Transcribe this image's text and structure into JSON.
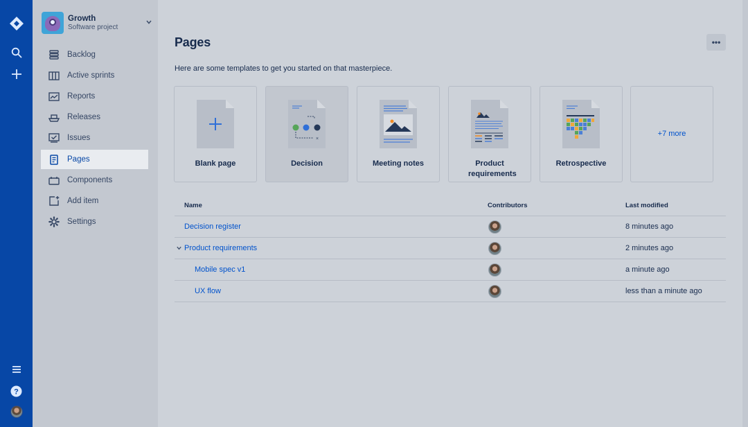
{
  "project": {
    "name": "Growth",
    "type": "Software project"
  },
  "sidebar": {
    "items": [
      {
        "label": "Backlog",
        "icon": "backlog-icon"
      },
      {
        "label": "Active sprints",
        "icon": "board-icon"
      },
      {
        "label": "Reports",
        "icon": "chart-icon"
      },
      {
        "label": "Releases",
        "icon": "ship-icon"
      },
      {
        "label": "Issues",
        "icon": "issues-icon"
      },
      {
        "label": "Pages",
        "icon": "page-icon",
        "active": true
      },
      {
        "label": "Components",
        "icon": "component-icon"
      },
      {
        "label": "Add item",
        "icon": "add-item-icon"
      },
      {
        "label": "Settings",
        "icon": "gear-icon"
      }
    ]
  },
  "main": {
    "title": "Pages",
    "subtitle": "Here are some templates to get you started on that masterpiece.",
    "more_label": "•••",
    "templates": [
      {
        "label": "Blank page"
      },
      {
        "label": "Decision"
      },
      {
        "label": "Meeting notes"
      },
      {
        "label": "Product requirements"
      },
      {
        "label": "Retrospective"
      },
      {
        "label": "+7 more"
      }
    ]
  },
  "table": {
    "headers": {
      "name": "Name",
      "contributors": "Contributors",
      "modified": "Last modified"
    },
    "rows": [
      {
        "name": "Decision register",
        "modified": "8 minutes ago"
      },
      {
        "name": "Product requirements",
        "modified": "2 minutes ago",
        "expanded": true
      },
      {
        "name": "Mobile spec v1",
        "modified": "a minute ago"
      },
      {
        "name": "UX flow",
        "modified": "less than a minute ago"
      }
    ]
  },
  "colors": {
    "global_nav": "#0747a6",
    "link": "#0052cc",
    "text": "#172b4d"
  }
}
